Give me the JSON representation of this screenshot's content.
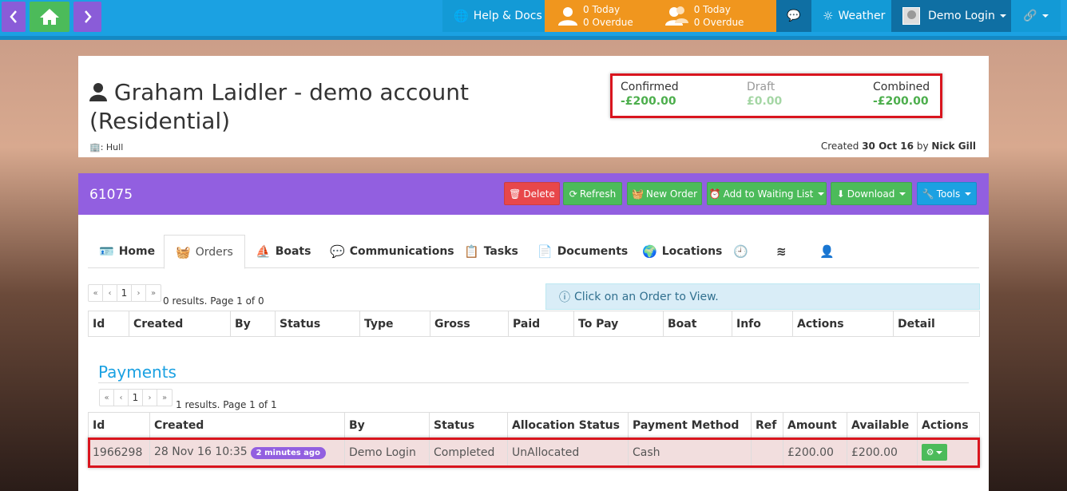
{
  "topbar": {
    "help_label": "Help & Docs",
    "my_tasks": {
      "today": "0 Today",
      "overdue": "0 Overdue"
    },
    "team_tasks": {
      "today": "0 Today",
      "overdue": "0 Overdue"
    },
    "weather_label": "Weather",
    "user_label": "Demo Login"
  },
  "header": {
    "title": "Graham Laidler - demo account (Residential)",
    "location": ": Hull",
    "created_prefix": "Created",
    "created_date": "30 Oct 16",
    "created_by_prefix": "by",
    "created_by": "Nick Gill",
    "balances": {
      "confirmed_label": "Confirmed",
      "confirmed_value": "-£200.00",
      "draft_label": "Draft",
      "draft_value": "£0.00",
      "combined_label": "Combined",
      "combined_value": "-£200.00"
    }
  },
  "account": {
    "number": "61075",
    "buttons": {
      "delete": "Delete",
      "refresh": "Refresh",
      "new_order": "New Order",
      "waiting_list": "Add to Waiting List",
      "download": "Download",
      "tools": "Tools"
    }
  },
  "tabs": {
    "home": "Home",
    "orders": "Orders",
    "boats": "Boats",
    "communications": "Communications",
    "tasks": "Tasks",
    "documents": "Documents",
    "locations": "Locations"
  },
  "orders": {
    "pager": {
      "first": "«",
      "prev": "‹",
      "page": "1",
      "next": "›",
      "last": "»"
    },
    "results_text": "0 results. Page 1 of 0",
    "info_text": "Click on an Order to View.",
    "columns": [
      "Id",
      "Created",
      "By",
      "Status",
      "Type",
      "Gross",
      "Paid",
      "To Pay",
      "Boat",
      "Info",
      "Actions",
      "Detail"
    ]
  },
  "payments": {
    "title": "Payments",
    "results_text": "1 results. Page 1 of 1",
    "columns": [
      "Id",
      "Created",
      "By",
      "Status",
      "Allocation Status",
      "Payment Method",
      "Ref",
      "Amount",
      "Available",
      "Actions"
    ],
    "row": {
      "id": "1966298",
      "created": "28 Nov 16 10:35",
      "badge": "2 minutes ago",
      "by": "Demo Login",
      "status": "Completed",
      "allocation": "UnAllocated",
      "method": "Cash",
      "ref": "",
      "amount": "£200.00",
      "available": "£200.00"
    }
  },
  "colors": {
    "topbar": "#1ba1e2",
    "purple": "#925fe0",
    "green": "#4cbb5a",
    "red": "#e8474a",
    "orange": "#f0961e",
    "highlight": "#d9151e"
  }
}
